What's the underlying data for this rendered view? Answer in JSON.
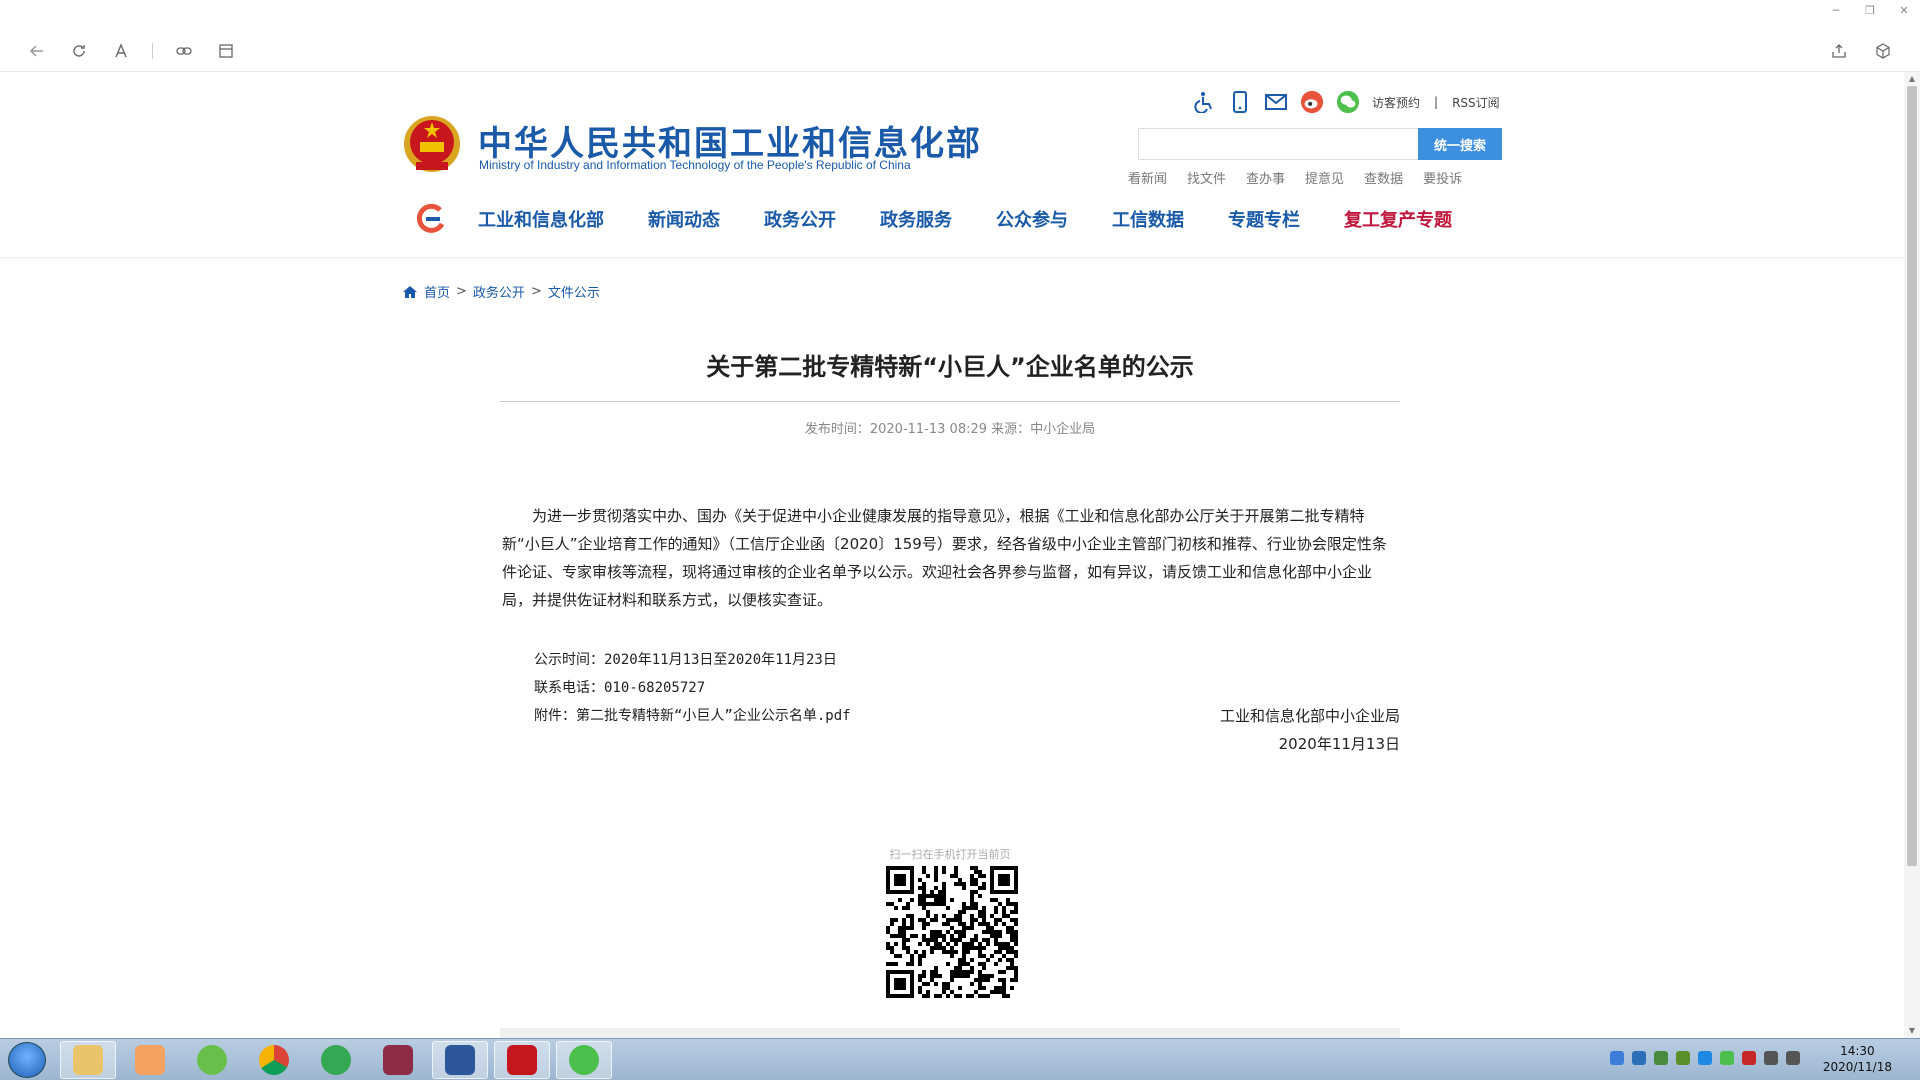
{
  "window": {
    "controls": [
      "─",
      "❐",
      "✕"
    ]
  },
  "site": {
    "title": "中华人民共和国工业和信息化部",
    "subtitle": "Ministry of Industry and Information Technology of the People's Republic of China",
    "util_links": [
      "访客预约",
      "RSS订阅"
    ],
    "util_pipe": "|",
    "search": {
      "placeholder": "",
      "button": "统一搜索"
    },
    "quick_links": [
      "看新闻",
      "找文件",
      "查办事",
      "提意见",
      "查数据",
      "要投诉"
    ],
    "nav": [
      "工业和信息化部",
      "新闻动态",
      "政务公开",
      "政务服务",
      "公众参与",
      "工信数据",
      "专题专栏"
    ],
    "nav_special": "复工复产专题",
    "colors": {
      "brand": "#1a5aa8",
      "special": "#c0183c",
      "search_btn": "#3d8fe0"
    }
  },
  "breadcrumb": {
    "items": [
      "首页",
      "政务公开",
      "文件公示"
    ],
    "sep": ">"
  },
  "article": {
    "title": "关于第二批专精特新“小巨人”企业名单的公示",
    "meta": "发布时间：2020-11-13 08:29  来源：中小企业局",
    "body": "为进一步贯彻落实中办、国办《关于促进中小企业健康发展的指导意见》，根据《工业和信息化部办公厅关于开展第二批专精特新“小巨人”企业培育工作的通知》（工信厅企业函〔2020〕159号）要求，经各省级中小企业主管部门初核和推荐、行业协会限定性条件论证、专家审核等流程，现将通过审核的企业名单予以公示。欢迎社会各界参与监督，如有异议，请反馈工业和信息化部中小企业局，并提供佐证材料和联系方式，以便核实查证。",
    "info": [
      "公示时间：2020年11月13日至2020年11月23日",
      "联系电话：010-68205727",
      "附件：第二批专精特新“小巨人”企业公示名单.pdf"
    ],
    "sign_org": "工业和信息化部中小企业局",
    "sign_date": "2020年11月13日",
    "qr_caption": "扫一扫在手机打开当前页"
  },
  "taskbar": {
    "clock_time": "14:30",
    "clock_date": "2020/11/18"
  }
}
